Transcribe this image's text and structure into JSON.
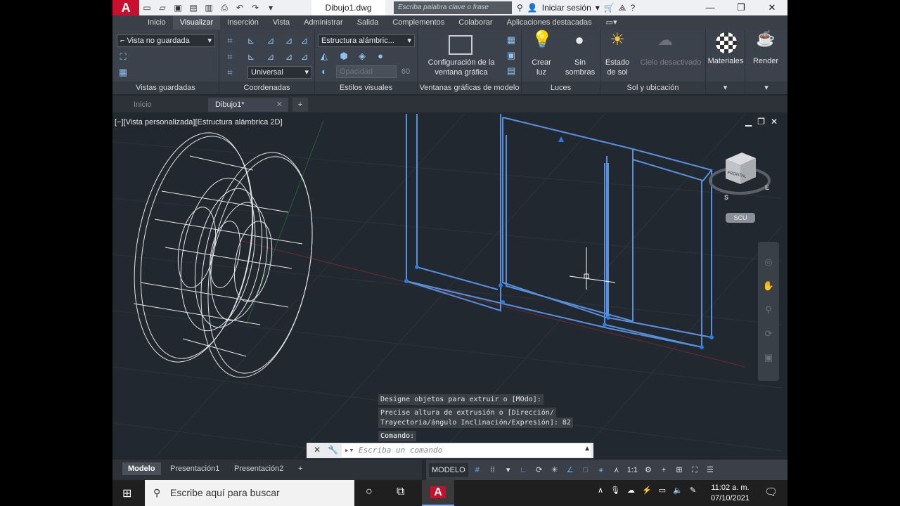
{
  "titlebar": {
    "file_name": "Dibujo1.dwg",
    "search_placeholder": "Escriba palabra clave o frase",
    "sign_in": "Iniciar sesión"
  },
  "menu": {
    "tabs": [
      "Inicio",
      "Visualizar",
      "Inserción",
      "Vista",
      "Administrar",
      "Salida",
      "Complementos",
      "Colaborar",
      "Aplicaciones destacadas"
    ],
    "active": "Visualizar"
  },
  "ribbon": {
    "saved_views": {
      "combo": "Vista no guardada",
      "title": "Vistas guardadas"
    },
    "coords": {
      "combo": "Universal",
      "title": "Coordenadas"
    },
    "visual_styles": {
      "combo": "Estructura alámbric...",
      "opacity_label": "Opacidad",
      "opacity_value": "60",
      "title": "Estilos visuales"
    },
    "viewports": {
      "config_label": "Configuración de la ventana gráfica",
      "title": "Ventanas gráficas de modelo"
    },
    "lights": {
      "create": "Crear luz",
      "no_shadows": "Sin sombras",
      "title": "Luces"
    },
    "sun": {
      "sun_state": "Estado de sol",
      "sky": "Cielo desactivado",
      "title": "Sol y ubicación"
    },
    "materials": {
      "label": "Materiales"
    },
    "render": {
      "label": "Render"
    }
  },
  "doctabs": {
    "start": "Inicio",
    "current": "Dibujo1*"
  },
  "viewport": {
    "label": "[−][Vista personalizada][Estructura alámbrica 2D]",
    "viewcube_face": "FRONTAL",
    "compass_s": "S",
    "compass_e": "E",
    "scu": "SCU"
  },
  "command": {
    "history": [
      "Designe objetos para extruir o [MOdo]:",
      "Precise altura de extrusión o [Dirección/",
      "Trayectoria/ángulo Inclinación/Expresión]: 82",
      "Comando:"
    ],
    "placeholder": "Escriba un comando"
  },
  "layouts": {
    "tabs": [
      "Modelo",
      "Presentación1",
      "Presentación2"
    ],
    "active": "Modelo"
  },
  "status": {
    "model": "MODELO",
    "scale": "1:1"
  },
  "taskbar": {
    "search_placeholder": "Escribe aquí para buscar",
    "time": "11:02 a. m.",
    "date": "07/10/2021"
  }
}
